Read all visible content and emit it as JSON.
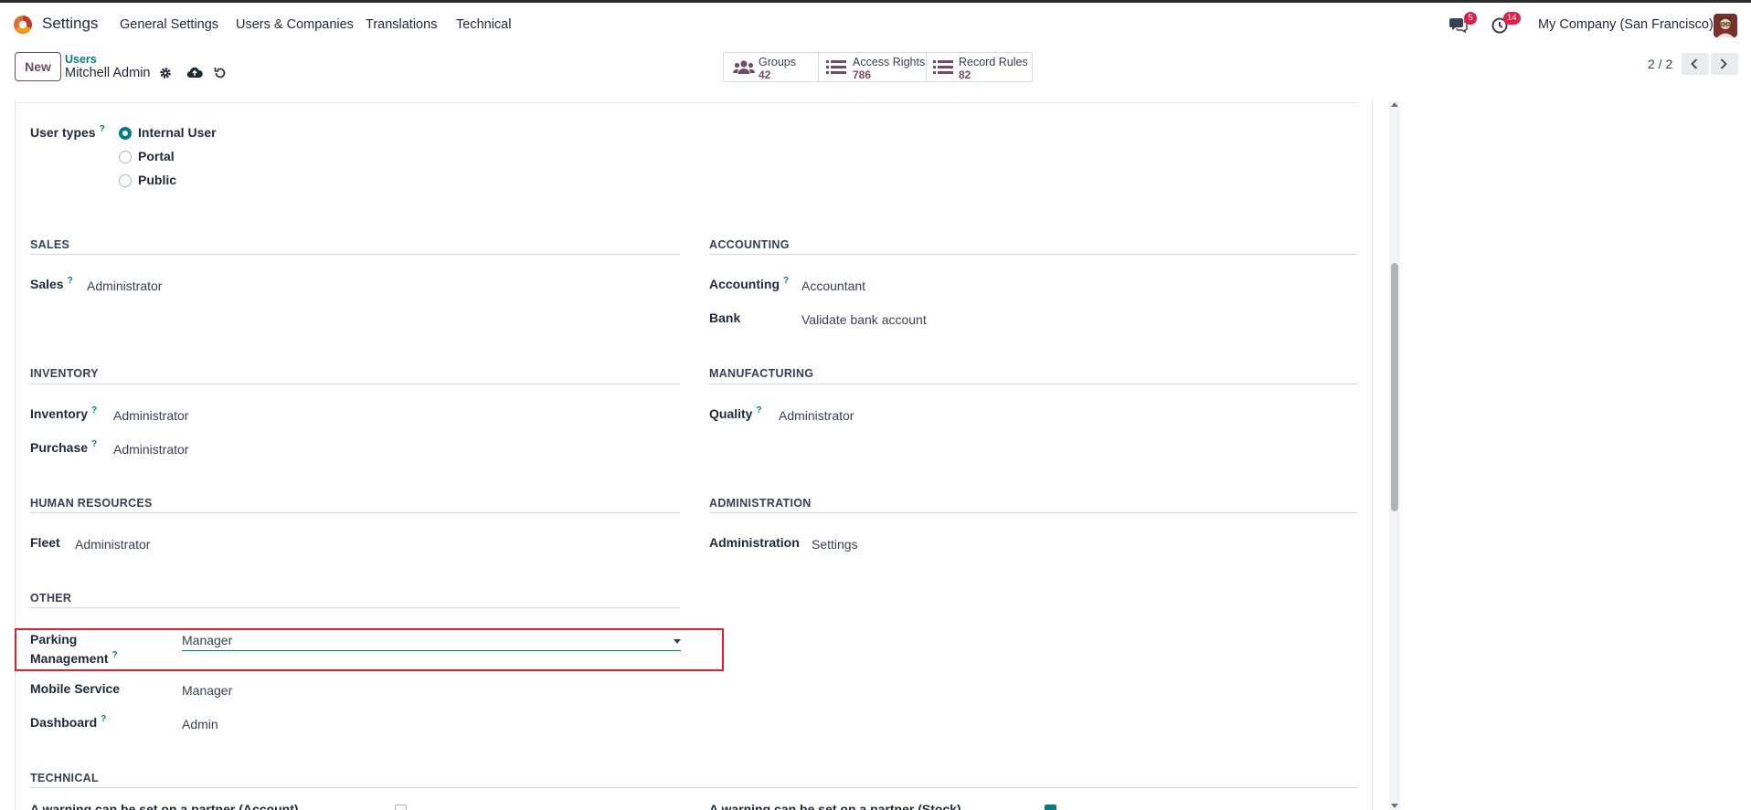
{
  "nav": {
    "app_name": "Settings",
    "menu": [
      "General Settings",
      "Users & Companies",
      "Translations",
      "Technical"
    ],
    "messages_count": "5",
    "activities_count": "14",
    "company": "My Company (San Francisco)"
  },
  "control": {
    "new_label": "New",
    "breadcrumb_parent": "Users",
    "breadcrumb_current": "Mitchell Admin",
    "pager": "2 / 2"
  },
  "smart_buttons": {
    "groups": {
      "label": "Groups",
      "value": "42"
    },
    "access_rights": {
      "label": "Access Rights",
      "value": "786"
    },
    "record_rules": {
      "label": "Record Rules",
      "value": "82"
    }
  },
  "form": {
    "user_types_label": "User types",
    "user_types": [
      "Internal User",
      "Portal",
      "Public"
    ],
    "user_type_selected": "Internal User",
    "q": "?",
    "sales": {
      "title": "SALES",
      "fields": [
        {
          "label": "Sales",
          "value": "Administrator",
          "help": true
        }
      ]
    },
    "accounting": {
      "title": "ACCOUNTING",
      "fields": [
        {
          "label": "Accounting",
          "value": "Accountant",
          "help": true
        },
        {
          "label": "Bank",
          "value": "Validate bank account",
          "help": false
        }
      ]
    },
    "inventory": {
      "title": "INVENTORY",
      "fields": [
        {
          "label": "Inventory",
          "value": "Administrator",
          "help": true
        },
        {
          "label": "Purchase",
          "value": "Administrator",
          "help": true
        }
      ]
    },
    "manufacturing": {
      "title": "MANUFACTURING",
      "fields": [
        {
          "label": "Quality",
          "value": "Administrator",
          "help": true
        }
      ]
    },
    "hr": {
      "title": "HUMAN RESOURCES",
      "fields": [
        {
          "label": "Fleet",
          "value": "Administrator",
          "help": false
        }
      ]
    },
    "administration": {
      "title": "ADMINISTRATION",
      "fields": [
        {
          "label": "Administration",
          "value": "Settings",
          "help": false
        }
      ]
    },
    "other": {
      "title": "OTHER",
      "parking_label_1": "Parking",
      "parking_label_2": "Management",
      "parking_value": "Manager",
      "mobile_label": "Mobile Service",
      "mobile_value": "Manager",
      "dashboard_label": "Dashboard",
      "dashboard_value": "Admin"
    },
    "technical": {
      "title": "TECHNICAL",
      "left_label": "A warning can be set on a partner (Account)",
      "right_label": "A warning can be set on a partner (Stock)"
    }
  },
  "colors": {
    "accent": "#017e84",
    "brand": "#714b67",
    "highlight": "#e11d2e"
  }
}
